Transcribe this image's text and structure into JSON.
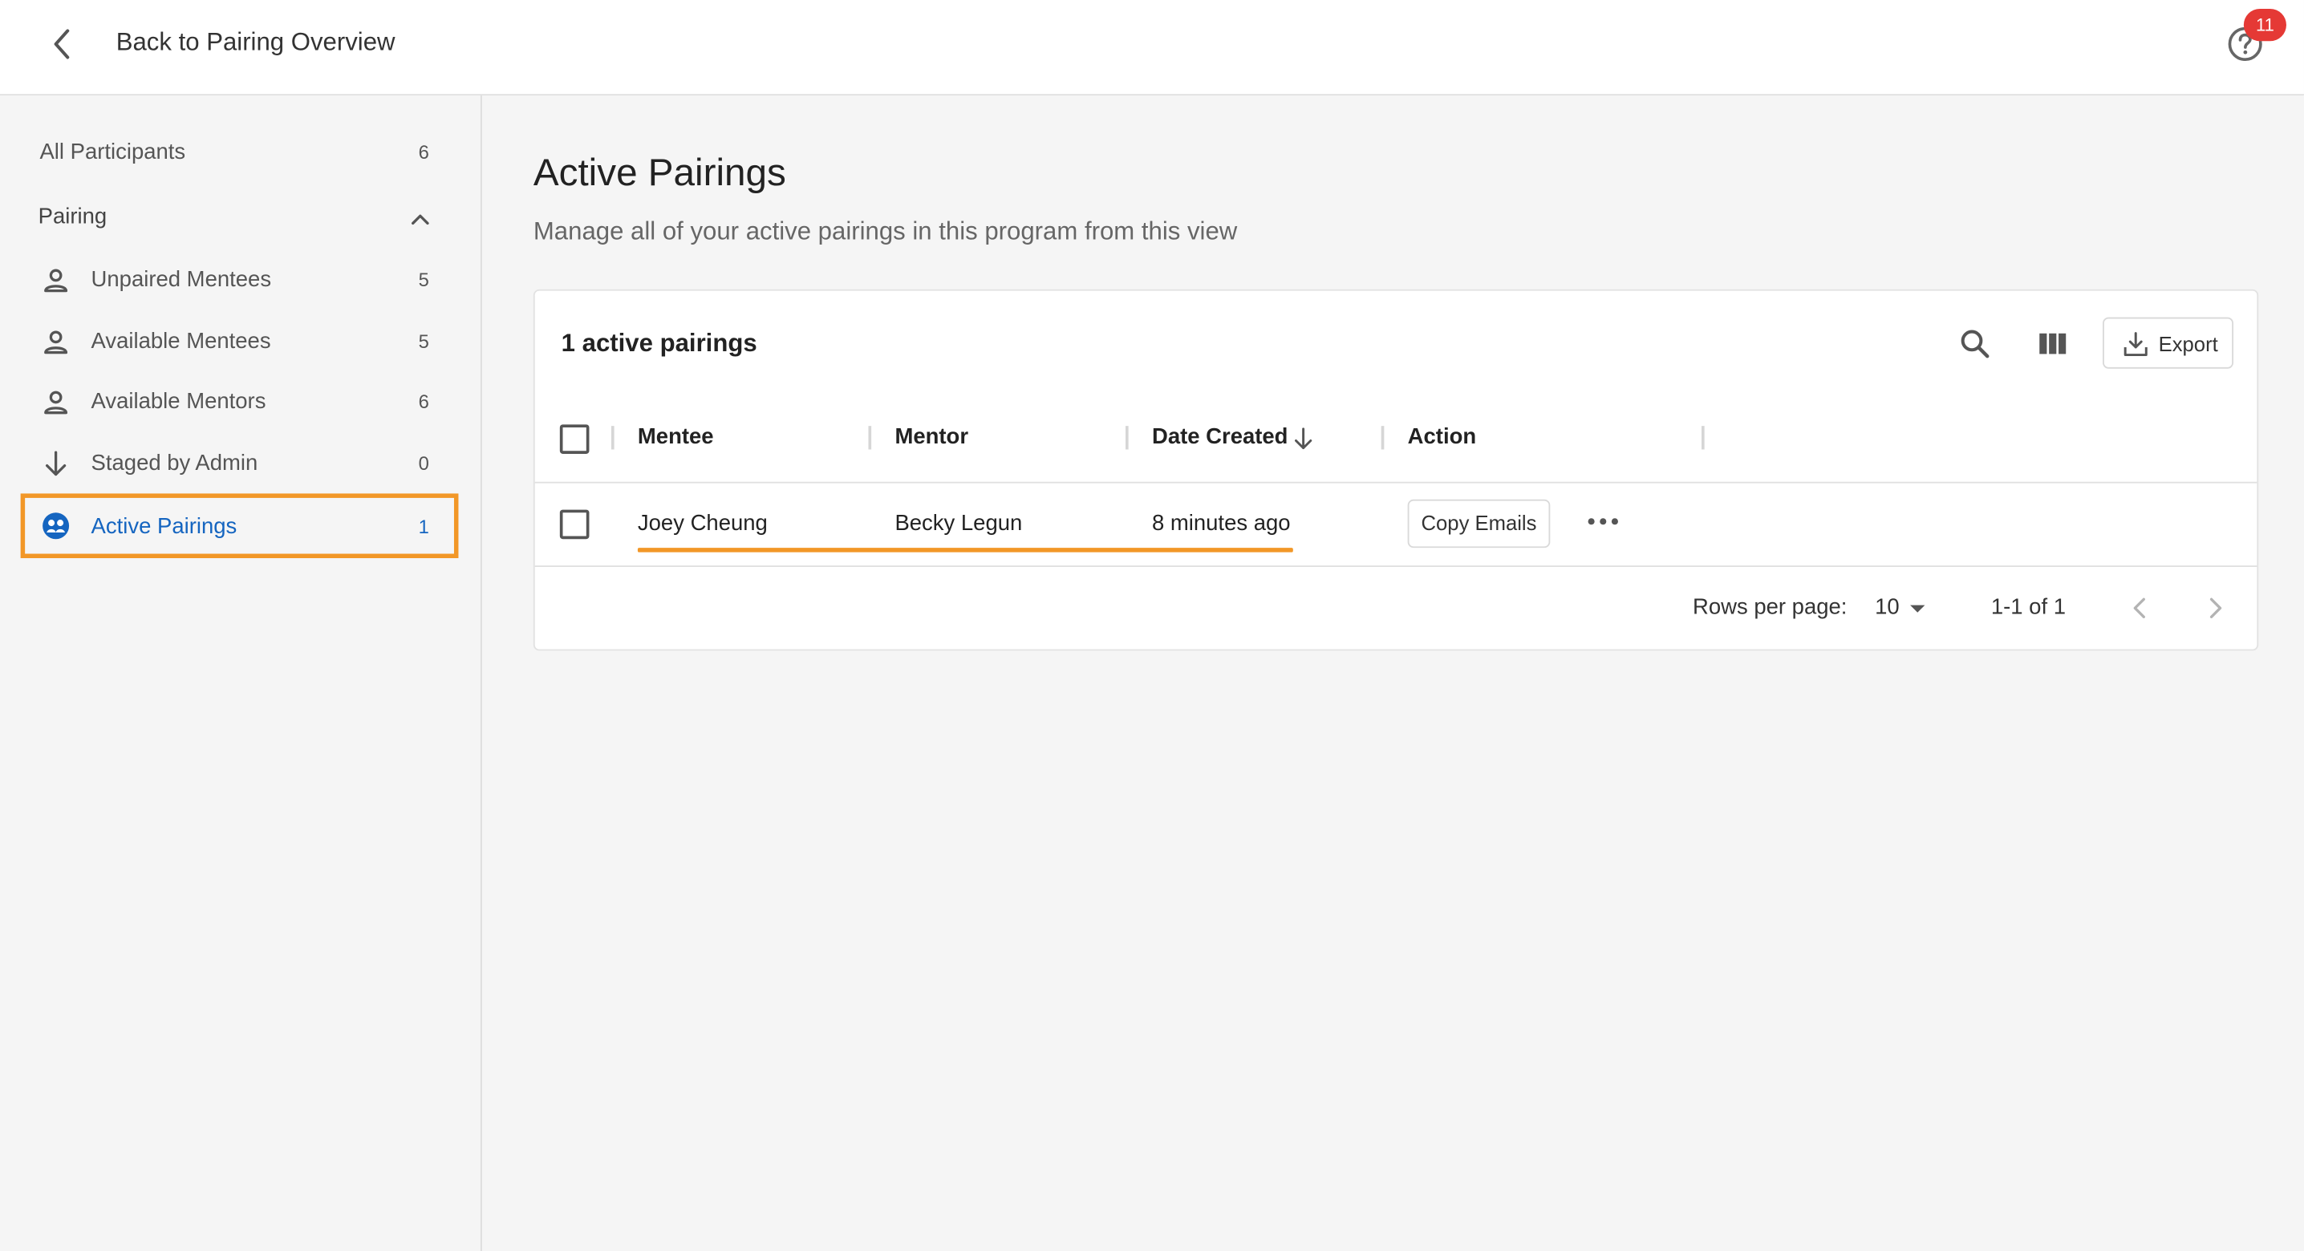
{
  "header": {
    "back_label": "Back to Pairing Overview",
    "help_badge": "11"
  },
  "sidebar": {
    "all": {
      "label": "All Participants",
      "count": "6"
    },
    "group_label": "Pairing",
    "items": [
      {
        "label": "Unpaired Mentees",
        "count": "5",
        "icon": "person-icon"
      },
      {
        "label": "Available Mentees",
        "count": "5",
        "icon": "person-icon"
      },
      {
        "label": "Available Mentors",
        "count": "6",
        "icon": "person-icon"
      },
      {
        "label": "Staged by Admin",
        "count": "0",
        "icon": "arrow-down-icon"
      },
      {
        "label": "Active Pairings",
        "count": "1",
        "icon": "pairing-icon",
        "active": true
      }
    ]
  },
  "main": {
    "title": "Active Pairings",
    "subtitle": "Manage all of your active pairings in this program from this view"
  },
  "table": {
    "title": "1 active pairings",
    "export_label": "Export",
    "columns": [
      "Mentee",
      "Mentor",
      "Date Created",
      "Action"
    ],
    "rows": [
      {
        "mentee": "Joey Cheung",
        "mentor": "Becky Legun",
        "date": "8 minutes ago",
        "action": "Copy Emails"
      }
    ],
    "pagination": {
      "rows_label": "Rows per page:",
      "rows_value": "10",
      "range": "1-1 of 1"
    }
  },
  "colors": {
    "accent": "#1565c0",
    "highlight": "#f29727",
    "badge": "#e53935"
  }
}
